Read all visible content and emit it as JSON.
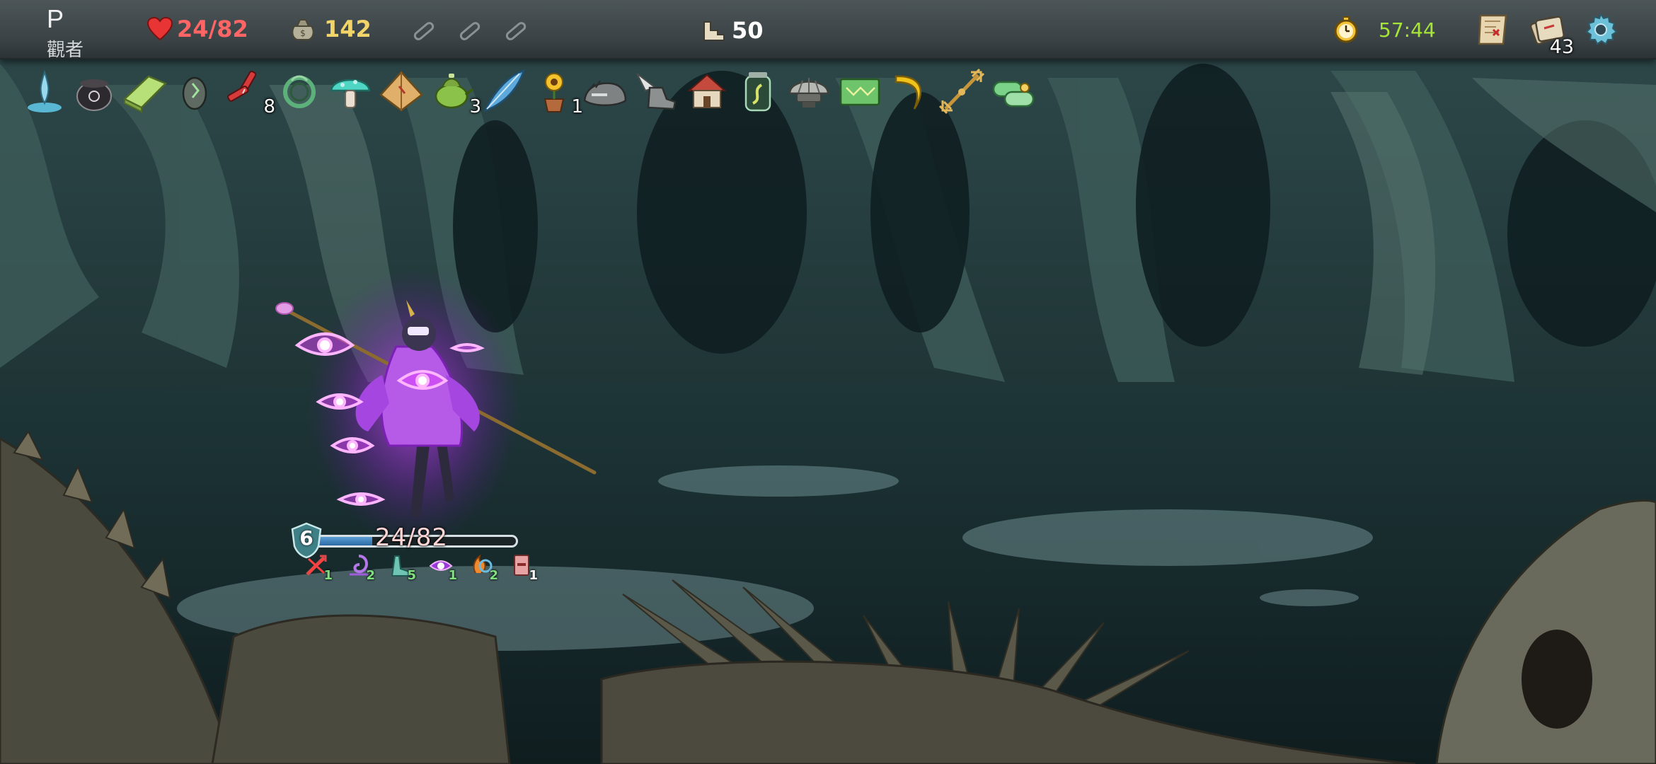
{
  "player": {
    "name": "P",
    "role": "觀者"
  },
  "stats": {
    "hp": "24/82",
    "gold": "142",
    "floor": "50",
    "time": "57:44",
    "deck_count": "43"
  },
  "potions": [
    {
      "icon": "empty-potion-slot-icon"
    },
    {
      "icon": "empty-potion-slot-icon"
    },
    {
      "icon": "empty-potion-slot-icon"
    }
  ],
  "top_right_icons": [
    "timer-icon",
    "map-icon",
    "deck-icon",
    "settings-gear-icon"
  ],
  "relics": [
    {
      "icon": "pure-water-droplet-icon",
      "count": ""
    },
    {
      "icon": "black-cauldron-icon",
      "count": ""
    },
    {
      "icon": "green-gold-bar-icon",
      "count": ""
    },
    {
      "icon": "egg-icon",
      "count": ""
    },
    {
      "icon": "red-nunchaku-icon",
      "count": "8"
    },
    {
      "icon": "green-wreath-icon",
      "count": ""
    },
    {
      "icon": "teal-mushroom-icon",
      "count": ""
    },
    {
      "icon": "pyramid-icon",
      "count": ""
    },
    {
      "icon": "green-teapot-icon",
      "count": "3"
    },
    {
      "icon": "blue-feather-icon",
      "count": ""
    },
    {
      "icon": "potted-sunflower-icon",
      "count": "1"
    },
    {
      "icon": "grey-war-beast-icon",
      "count": ""
    },
    {
      "icon": "grey-winged-boot-icon",
      "count": ""
    },
    {
      "icon": "small-hut-icon",
      "count": ""
    },
    {
      "icon": "snake-jar-icon",
      "count": ""
    },
    {
      "icon": "shell-cup-icon",
      "count": ""
    },
    {
      "icon": "green-card-icon",
      "count": ""
    },
    {
      "icon": "golden-banana-icon",
      "count": ""
    },
    {
      "icon": "golden-vajra-icon",
      "count": ""
    },
    {
      "icon": "green-scroll-icon",
      "count": ""
    }
  ],
  "character": {
    "hp_text": "24/82",
    "hp_fraction": 0.29,
    "block": "6",
    "buffs": [
      {
        "icon": "strength-down-icon",
        "value": "1",
        "color": "#7fe07f"
      },
      {
        "icon": "mantra-swirl-icon",
        "value": "2",
        "color": "#7fe07f"
      },
      {
        "icon": "foot-dexterity-icon",
        "value": "5",
        "color": "#7fe07f"
      },
      {
        "icon": "third-eye-icon",
        "value": "1",
        "color": "#7fe07f"
      },
      {
        "icon": "flame-ring-icon",
        "value": "2",
        "color": "#7fe07f"
      },
      {
        "icon": "card-block-icon",
        "value": "1",
        "color": "#ffffff"
      }
    ]
  },
  "colors": {
    "hp_red": "#ff6565",
    "gold": "#f1d56a",
    "timer_green": "#a6e43a",
    "stance_purple": "#c040ff"
  }
}
